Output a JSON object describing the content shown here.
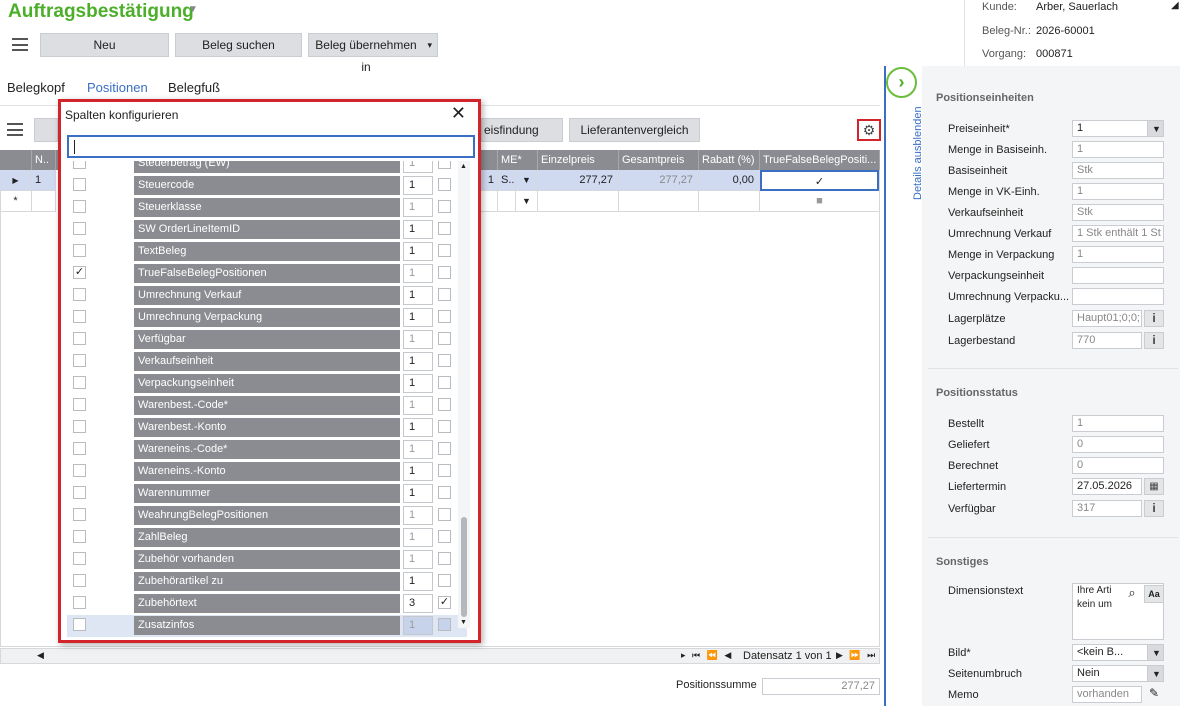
{
  "window": {
    "title": "Auftragsbestätigung"
  },
  "toolbar": {
    "new_label": "Neu",
    "search_label": "Beleg suchen",
    "take_label": "Beleg übernehmen in"
  },
  "customer": {
    "kunde_label": "Kunde:",
    "kunde_value": "Arber, Sauerlach",
    "beleg_label": "Beleg-Nr.:",
    "beleg_value": "2026-60001",
    "vorgang_label": "Vorgang:",
    "vorgang_value": "000871"
  },
  "tabs": [
    {
      "label": "Belegkopf"
    },
    {
      "label": "Positionen",
      "active": true
    },
    {
      "label": "Belegfuß"
    }
  ],
  "grid_buttons": {
    "preisfindung": "eisfindung",
    "lieferantenvergleich": "Lieferantenvergleich"
  },
  "grid": {
    "columns": {
      "nr": "N..",
      "me": "ME*",
      "einzelpreis": "Einzelpreis",
      "gesamtpreis": "Gesamtpreis",
      "rabatt": "Rabatt (%)",
      "truefalse": "TrueFalseBelegPositi..."
    },
    "row1": {
      "nr": "1",
      "qty": "1",
      "me": "S..",
      "einzelpreis": "277,27",
      "gesamtpreis": "277,27",
      "rabatt": "0,00"
    },
    "new_row_marker": "*"
  },
  "navigator": {
    "text": "Datensatz 1 von 1"
  },
  "summary": {
    "label": "Positionssumme",
    "value": "277,27"
  },
  "popup": {
    "title": "Spalten konfigurieren",
    "search_value": "",
    "rows": [
      {
        "checked": false,
        "name": "Steuerbetrag (EW)",
        "order": "1",
        "dim": true,
        "visible": false
      },
      {
        "checked": false,
        "name": "Steuercode",
        "order": "1",
        "dim": false,
        "visible": false
      },
      {
        "checked": false,
        "name": "Steuerklasse",
        "order": "1",
        "dim": true,
        "visible": false
      },
      {
        "checked": false,
        "name": "SW OrderLineItemID",
        "order": "1",
        "dim": false,
        "visible": false
      },
      {
        "checked": false,
        "name": "TextBeleg",
        "order": "1",
        "dim": false,
        "visible": false
      },
      {
        "checked": true,
        "name": "TrueFalseBelegPositionen",
        "order": "1",
        "dim": true,
        "visible": false
      },
      {
        "checked": false,
        "name": "Umrechnung Verkauf",
        "order": "1",
        "dim": false,
        "visible": false
      },
      {
        "checked": false,
        "name": "Umrechnung Verpackung",
        "order": "1",
        "dim": false,
        "visible": false
      },
      {
        "checked": false,
        "name": "Verfügbar",
        "order": "1",
        "dim": true,
        "visible": false
      },
      {
        "checked": false,
        "name": "Verkaufseinheit",
        "order": "1",
        "dim": false,
        "visible": false
      },
      {
        "checked": false,
        "name": "Verpackungseinheit",
        "order": "1",
        "dim": false,
        "visible": false
      },
      {
        "checked": false,
        "name": "Warenbest.-Code*",
        "order": "1",
        "dim": true,
        "visible": false
      },
      {
        "checked": false,
        "name": "Warenbest.-Konto",
        "order": "1",
        "dim": false,
        "visible": false
      },
      {
        "checked": false,
        "name": "Wareneins.-Code*",
        "order": "1",
        "dim": true,
        "visible": false
      },
      {
        "checked": false,
        "name": "Wareneins.-Konto",
        "order": "1",
        "dim": false,
        "visible": false
      },
      {
        "checked": false,
        "name": "Warennummer",
        "order": "1",
        "dim": false,
        "visible": false
      },
      {
        "checked": false,
        "name": "WeahrungBelegPositionen",
        "order": "1",
        "dim": true,
        "visible": false
      },
      {
        "checked": false,
        "name": "ZahlBeleg",
        "order": "1",
        "dim": true,
        "visible": false
      },
      {
        "checked": false,
        "name": "Zubehör vorhanden",
        "order": "1",
        "dim": true,
        "visible": false
      },
      {
        "checked": false,
        "name": "Zubehörartikel zu",
        "order": "1",
        "dim": false,
        "visible": false
      },
      {
        "checked": false,
        "name": "Zubehörtext",
        "order": "3",
        "dim": false,
        "visible": true
      },
      {
        "checked": false,
        "name": "Zusatzinfos",
        "order": "1",
        "dim": true,
        "visible": false
      }
    ]
  },
  "details_toggle": {
    "label": "Details ausblenden"
  },
  "right_panel": {
    "positionseinheiten": {
      "title": "Positionseinheiten",
      "preiseinheit_label": "Preiseinheit*",
      "preiseinheit_value": "1",
      "menge_basis_label": "Menge in Basiseinh.",
      "menge_basis_value": "1",
      "basiseinheit_label": "Basiseinheit",
      "basiseinheit_value": "Stk",
      "menge_vk_label": "Menge in VK-Einh.",
      "menge_vk_value": "1",
      "verkaufseinheit_label": "Verkaufseinheit",
      "verkaufseinheit_value": "Stk",
      "umr_verkauf_label": "Umrechnung Verkauf",
      "umr_verkauf_value": "1 Stk enthält 1 St",
      "menge_verp_label": "Menge in Verpackung",
      "menge_verp_value": "1",
      "verp_einheit_label": "Verpackungseinheit",
      "verp_einheit_value": "",
      "umr_verp_label": "Umrechnung Verpacku...",
      "umr_verp_value": "",
      "lagerplaetze_label": "Lagerplätze",
      "lagerplaetze_value": "Haupt01;0;0;",
      "lagerbestand_label": "Lagerbestand",
      "lagerbestand_value": "770"
    },
    "positionsstatus": {
      "title": "Positionsstatus",
      "bestellt_label": "Bestellt",
      "bestellt_value": "1",
      "geliefert_label": "Geliefert",
      "geliefert_value": "0",
      "berechnet_label": "Berechnet",
      "berechnet_value": "0",
      "liefertermin_label": "Liefertermin",
      "liefertermin_value": "27.05.2026",
      "verfuegbar_label": "Verfügbar",
      "verfuegbar_value": "317"
    },
    "sonstiges": {
      "title": "Sonstiges",
      "dimensionstext_label": "Dimensionstext",
      "dimensionstext_value": "Ihre Arti kein um",
      "bild_label": "Bild*",
      "bild_value": "<kein B...",
      "seitenumbruch_label": "Seitenumbruch",
      "seitenumbruch_value": "Nein",
      "memo_label": "Memo",
      "memo_value": "vorhanden"
    }
  },
  "colors": {
    "accent_green": "#4caf2a",
    "highlight_red": "#d3242b",
    "link_blue": "#3a6fc4",
    "header_gray": "#8a8c91"
  }
}
